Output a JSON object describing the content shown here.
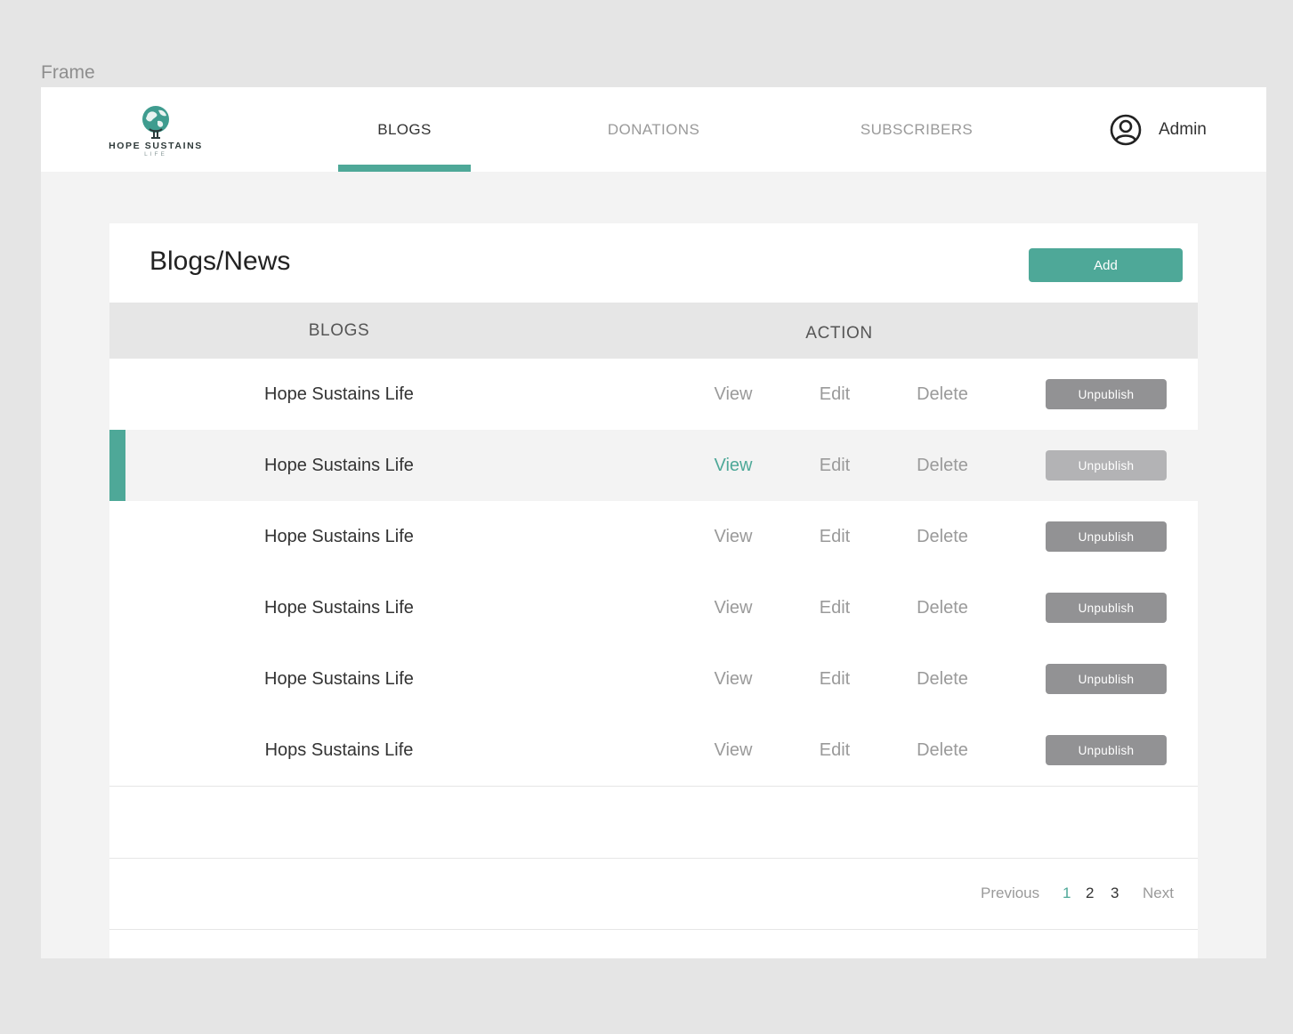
{
  "frame_label": "Frame",
  "brand": {
    "name": "HOPE SUSTAINS",
    "tagline": "LIFE"
  },
  "nav": {
    "tabs": [
      {
        "label": "BLOGS",
        "active": true
      },
      {
        "label": "DONATIONS",
        "active": false
      },
      {
        "label": "SUBSCRIBERS",
        "active": false
      }
    ],
    "user": {
      "name": "Admin",
      "icon": "user-circle-icon"
    }
  },
  "page": {
    "title": "Blogs/News",
    "add_label": "Add"
  },
  "table": {
    "columns": [
      "BLOGS",
      "ACTION"
    ],
    "rows": [
      {
        "title": "Hope Sustains Life",
        "view": "View",
        "edit": "Edit",
        "delete": "Delete",
        "unpublish": "Unpublish"
      },
      {
        "title": "Hope Sustains Life",
        "view": "View",
        "edit": "Edit",
        "delete": "Delete",
        "unpublish": "Unpublish"
      },
      {
        "title": "Hope Sustains Life",
        "view": "View",
        "edit": "Edit",
        "delete": "Delete",
        "unpublish": "Unpublish"
      },
      {
        "title": "Hope Sustains Life",
        "view": "View",
        "edit": "Edit",
        "delete": "Delete",
        "unpublish": "Unpublish"
      },
      {
        "title": "Hope Sustains Life",
        "view": "View",
        "edit": "Edit",
        "delete": "Delete",
        "unpublish": "Unpublish"
      },
      {
        "title": "Hops Sustains Life",
        "view": "View",
        "edit": "Edit",
        "delete": "Delete",
        "unpublish": "Unpublish"
      }
    ],
    "highlighted_row": 1
  },
  "pagination": {
    "previous": "Previous",
    "pages": [
      "1",
      "2",
      "3"
    ],
    "current": "1",
    "next": "Next"
  },
  "colors": {
    "accent": "#4ea898",
    "unpublish_button": "#929294",
    "header_bg": "#e6e6e6"
  }
}
